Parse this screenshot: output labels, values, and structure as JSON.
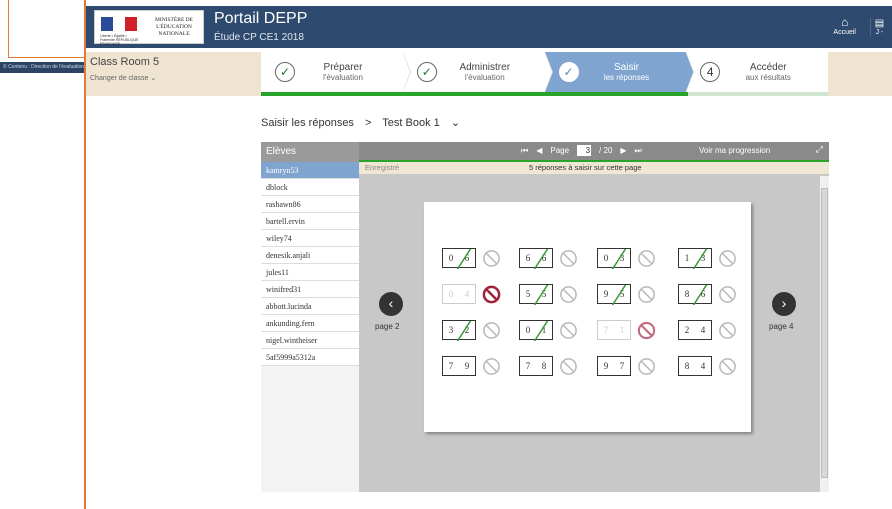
{
  "background": {
    "footer_text": "© Contenu : Direction de l'évaluation, de la prospective et de la performance - Tous droits réservés."
  },
  "header": {
    "logo_text": "MINISTÈRE DE L'ÉDUCATION NATIONALE",
    "logo_sub": "Liberté • Égalité • Fraternité RÉPUBLIQUE FRANÇAISE",
    "title": "Portail DEPP",
    "subtitle": "Étude CP CE1 2018",
    "home_label": "Accueil",
    "calc_label": "J -"
  },
  "classbar": {
    "class_name": "Class Room 5",
    "change_label": "Changer de classe"
  },
  "steps": [
    {
      "l1": "Préparer",
      "l2": "l'évaluation",
      "mark": "✓",
      "state": "done"
    },
    {
      "l1": "Administrer",
      "l2": "l'évaluation",
      "mark": "✓",
      "state": "done"
    },
    {
      "l1": "Saisir",
      "l2": "les réponses",
      "mark": "✓",
      "state": "active"
    },
    {
      "l1": "Accéder",
      "l2": "aux résultats",
      "mark": "4",
      "state": "todo"
    }
  ],
  "breadcrumb": {
    "root": "Saisir les réponses",
    "sep": ">",
    "current": "Test Book 1"
  },
  "students": {
    "header": "Elèves",
    "items": [
      "kamryn53",
      "dblock",
      "rashawn86",
      "bartell.ervin",
      "wiley74",
      "denesik.anjali",
      "jules11",
      "winifred31",
      "abbott.lucinda",
      "ankunding.fern",
      "nigel.wintheiser",
      "5af5999a5312a"
    ],
    "selected_index": 0
  },
  "toolbar": {
    "page_label": "Page",
    "page_current": "3",
    "page_total": "/ 20",
    "progress_link": "Voir ma progression"
  },
  "status": {
    "saved": "Enregistré",
    "todo": "5 réponses à saisir sur cette page"
  },
  "page_nav": {
    "prev_label": "page 2",
    "next_label": "page 4"
  },
  "grid": [
    [
      {
        "d": [
          "0",
          "6"
        ],
        "struck": true,
        "faded": false,
        "icon": "none"
      },
      {
        "d": [
          "6",
          "6"
        ],
        "struck": true,
        "faded": false,
        "icon": "none"
      },
      {
        "d": [
          "0",
          "3"
        ],
        "struck": true,
        "faded": false,
        "icon": "none"
      },
      {
        "d": [
          "1",
          "3"
        ],
        "struck": true,
        "faded": false,
        "icon": "none"
      }
    ],
    [
      {
        "d": [
          "0",
          "4"
        ],
        "struck": false,
        "faded": true,
        "icon": "blocked"
      },
      {
        "d": [
          "5",
          "5"
        ],
        "struck": true,
        "faded": false,
        "icon": "none"
      },
      {
        "d": [
          "9",
          "5"
        ],
        "struck": true,
        "faded": false,
        "icon": "none"
      },
      {
        "d": [
          "8",
          "6"
        ],
        "struck": true,
        "faded": false,
        "icon": "none"
      }
    ],
    [
      {
        "d": [
          "3",
          "2"
        ],
        "struck": true,
        "faded": false,
        "icon": "none"
      },
      {
        "d": [
          "0",
          "1"
        ],
        "struck": true,
        "faded": false,
        "icon": "none"
      },
      {
        "d": [
          "7",
          "1"
        ],
        "struck": false,
        "faded": true,
        "icon": "blocked-light"
      },
      {
        "d": [
          "2",
          "4"
        ],
        "struck": false,
        "faded": false,
        "icon": "none"
      }
    ],
    [
      {
        "d": [
          "7",
          "9"
        ],
        "struck": false,
        "faded": false,
        "icon": "none"
      },
      {
        "d": [
          "7",
          "8"
        ],
        "struck": false,
        "faded": false,
        "icon": "none"
      },
      {
        "d": [
          "9",
          "7"
        ],
        "struck": false,
        "faded": false,
        "icon": "none"
      },
      {
        "d": [
          "8",
          "4"
        ],
        "struck": false,
        "faded": false,
        "icon": "none"
      }
    ]
  ],
  "colors": {
    "header_bg": "#2e4a6f",
    "active_step": "#7fa4cf",
    "progress_green": "#2aa32a",
    "strike_green": "#3a9a3a",
    "blocked_red": "#a0203a"
  }
}
